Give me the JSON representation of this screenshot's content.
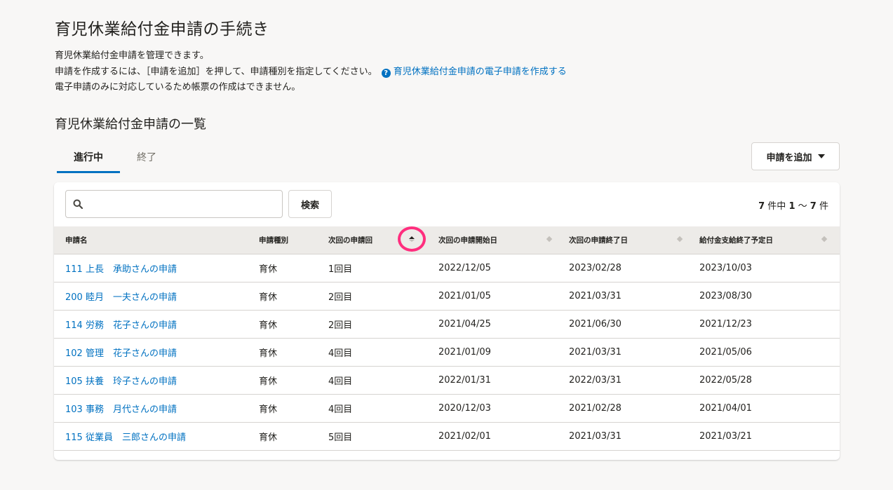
{
  "page": {
    "title": "育児休業給付金申請の手続き",
    "desc_line1": "育児休業給付金申請を管理できます。",
    "desc_line2": "申請を作成するには、［申請を追加］を押して、申請種別を指定してください。",
    "help_link": "育児休業給付金申請の電子申請を作成する",
    "desc_line3": "電子申請のみに対応しているため帳票の作成はできません。",
    "section_title": "育児休業給付金申請の一覧"
  },
  "tabs": [
    {
      "label": "進行中",
      "active": true
    },
    {
      "label": "終了",
      "active": false
    }
  ],
  "toolbar": {
    "add_label": "申請を追加",
    "search_placeholder": "",
    "search_label": "検索",
    "count_total": "7",
    "count_mid": "件中",
    "count_from": "1",
    "count_sep": "～",
    "count_to": "7",
    "count_unit": "件"
  },
  "table": {
    "columns": [
      "申請名",
      "申請種別",
      "次回の申請回",
      "次回の申請開始日",
      "次回の申請終了日",
      "給付金支給終了予定日"
    ],
    "rows": [
      {
        "name": "111 上長　承助さんの申請",
        "type": "育休",
        "round": "1回目",
        "start": "2022/12/05",
        "end": "2023/02/28",
        "pay_end": "2023/10/03"
      },
      {
        "name": "200 睦月　一夫さんの申請",
        "type": "育休",
        "round": "2回目",
        "start": "2021/01/05",
        "end": "2021/03/31",
        "pay_end": "2023/08/30"
      },
      {
        "name": "114 労務　花子さんの申請",
        "type": "育休",
        "round": "2回目",
        "start": "2021/04/25",
        "end": "2021/06/30",
        "pay_end": "2021/12/23"
      },
      {
        "name": "102 管理　花子さんの申請",
        "type": "育休",
        "round": "4回目",
        "start": "2021/01/09",
        "end": "2021/03/31",
        "pay_end": "2021/05/06"
      },
      {
        "name": "105 扶養　玲子さんの申請",
        "type": "育休",
        "round": "4回目",
        "start": "2022/01/31",
        "end": "2022/03/31",
        "pay_end": "2022/05/28"
      },
      {
        "name": "103 事務　月代さんの申請",
        "type": "育休",
        "round": "4回目",
        "start": "2020/12/03",
        "end": "2021/02/28",
        "pay_end": "2021/04/01"
      },
      {
        "name": "115 従業員　三郎さんの申請",
        "type": "育休",
        "round": "5回目",
        "start": "2021/02/01",
        "end": "2021/03/31",
        "pay_end": "2021/03/21"
      }
    ]
  },
  "colors": {
    "link": "#0071c1",
    "highlight_ring": "#ff2e7e",
    "header_bg": "#edebe8"
  }
}
